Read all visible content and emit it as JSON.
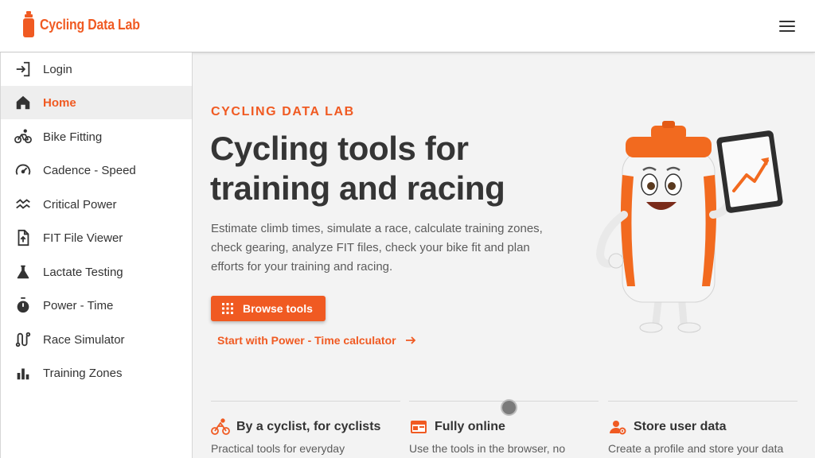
{
  "app": {
    "brand": "Cycling Data Lab",
    "accent_color": "#f05a22",
    "menu_icon": "hamburger-menu-icon"
  },
  "sidebar": {
    "items": [
      {
        "label": "Login",
        "icon": "login-icon"
      },
      {
        "label": "Home",
        "icon": "home-icon",
        "active": true
      },
      {
        "label": "Bike Fitting",
        "icon": "bicycle-icon"
      },
      {
        "label": "Cadence - Speed",
        "icon": "speedometer-icon"
      },
      {
        "label": "Critical Power",
        "icon": "power-curve-icon"
      },
      {
        "label": "FIT File Viewer",
        "icon": "file-upload-icon"
      },
      {
        "label": "Lactate Testing",
        "icon": "flask-icon"
      },
      {
        "label": "Power - Time",
        "icon": "stopwatch-icon"
      },
      {
        "label": "Race Simulator",
        "icon": "route-icon"
      },
      {
        "label": "Training Zones",
        "icon": "bar-chart-icon"
      }
    ]
  },
  "hero": {
    "eyebrow": "CYCLING DATA LAB",
    "headline": "Cycling tools for training and racing",
    "description": "Estimate climb times, simulate a race, calculate training zones, check gearing, analyze FIT files, check your bike fit and plan efforts for your training and racing.",
    "primary_button": "Browse tools",
    "secondary_link": "Start with Power - Time calculator"
  },
  "features": [
    {
      "title": "By a cyclist, for cyclists",
      "text": "Practical tools for everyday",
      "icon": "cyclist-icon"
    },
    {
      "title": "Fully online",
      "text": "Use the tools in the browser, no",
      "icon": "browser-window-icon"
    },
    {
      "title": "Store user data",
      "text": "Create a profile and store your data",
      "icon": "user-settings-icon"
    }
  ]
}
